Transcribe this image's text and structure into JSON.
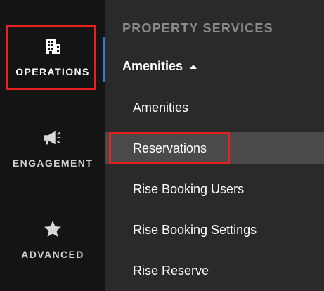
{
  "sidebar": {
    "items": [
      {
        "label": "OPERATIONS",
        "icon": "building-icon"
      },
      {
        "label": "ENGAGEMENT",
        "icon": "megaphone-icon"
      },
      {
        "label": "ADVANCED",
        "icon": "star-icon"
      }
    ]
  },
  "panel": {
    "section_title": "PROPERTY SERVICES",
    "group": {
      "label": "Amenities",
      "items": [
        {
          "label": "Amenities"
        },
        {
          "label": "Reservations"
        },
        {
          "label": "Rise Booking Users"
        },
        {
          "label": "Rise Booking Settings"
        },
        {
          "label": "Rise Reserve"
        }
      ]
    }
  },
  "colors": {
    "accent": "#2d7fd8",
    "annotation": "#e81f1f",
    "selected_bg": "#4a4a4a"
  }
}
